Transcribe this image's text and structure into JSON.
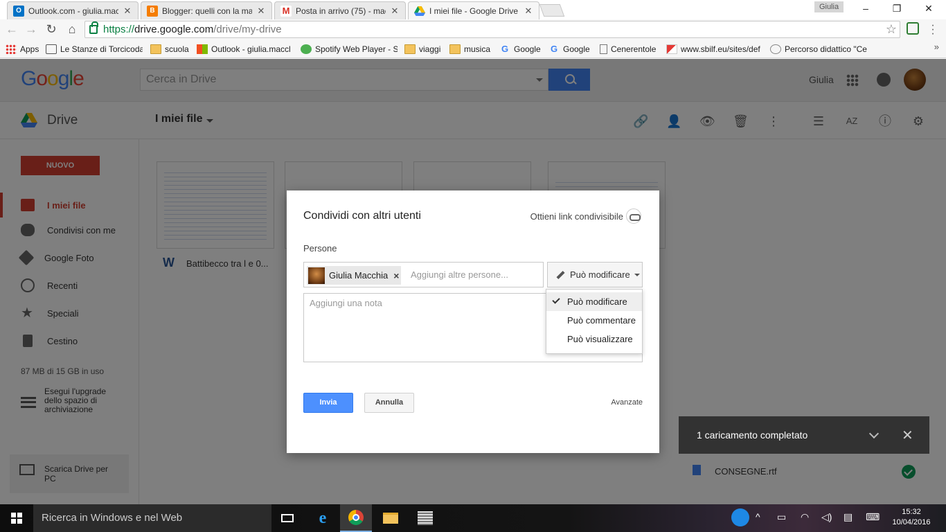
{
  "browser": {
    "tabs": [
      {
        "title": "Outlook.com - giulia.macc",
        "favicon": "outlook-icon",
        "color": "#0072c6"
      },
      {
        "title": "Blogger: quelli con la mac",
        "favicon": "blogger-icon",
        "color": "#f57d00"
      },
      {
        "title": "Posta in arrivo (75) - macc",
        "favicon": "gmail-icon",
        "color": "#d93025"
      },
      {
        "title": "I miei file - Google Drive",
        "favicon": "drive-icon",
        "color": "#fbbc05",
        "active": true
      }
    ],
    "profile_name": "Giulia",
    "window_controls": {
      "minimize": "–",
      "restore": "❐",
      "close": "✕"
    },
    "url": {
      "scheme": "https://",
      "host": "drive.google.com",
      "path": "/drive/my-drive"
    },
    "bookmarks": [
      {
        "label": "Apps",
        "icon": "apps-grid-icon"
      },
      {
        "label": "Le Stanze di Torcicoda",
        "icon": "bookmark-icon"
      },
      {
        "label": "scuola",
        "icon": "folder-icon"
      },
      {
        "label": "Outlook - giulia.maccl",
        "icon": "microsoft-icon"
      },
      {
        "label": "Spotify Web Player - S",
        "icon": "spotify-icon"
      },
      {
        "label": "viaggi",
        "icon": "folder-icon"
      },
      {
        "label": "musica",
        "icon": "folder-icon"
      },
      {
        "label": "Google",
        "icon": "google-icon"
      },
      {
        "label": "Google",
        "icon": "google-icon"
      },
      {
        "label": "Cenerentole",
        "icon": "page-icon"
      },
      {
        "label": "www.sbilf.eu/sites/def",
        "icon": "page-icon"
      },
      {
        "label": "Percorso didattico \"Ce",
        "icon": "seal-icon"
      }
    ],
    "bookmarks_more": "»"
  },
  "drive": {
    "logo_letters": [
      "G",
      "o",
      "o",
      "g",
      "l",
      "e"
    ],
    "search_placeholder": "Cerca in Drive",
    "user_name": "Giulia",
    "app_name": "Drive",
    "location": "I miei file",
    "toolbar_icons": [
      "link-icon",
      "add-person-icon",
      "preview-eye-icon",
      "trash-icon",
      "more-vert-icon",
      "list-view-icon",
      "sort-az-icon",
      "info-icon",
      "settings-gear-icon"
    ],
    "toolbar_glyphs": [
      "🔗",
      "👤",
      "👁",
      "🗑",
      "⋮",
      "☰",
      "AZ",
      "ⓘ",
      "⚙"
    ],
    "new_button": "NUOVO",
    "nav": [
      {
        "label": "I miei file",
        "active": true
      },
      {
        "label": "Condivisi con me"
      },
      {
        "label": "Google Foto"
      },
      {
        "label": "Recenti"
      },
      {
        "label": "Speciali"
      },
      {
        "label": "Cestino"
      }
    ],
    "storage": "87 MB di 15 GB in uso",
    "upgrade": "Esegui l'upgrade dello spazio di archiviazione",
    "download": "Scarica Drive per PC",
    "file_name": "Battibecco tra l e 0...",
    "file_type_glyph": "W"
  },
  "share_dialog": {
    "title": "Condividi con altri utenti",
    "get_link": "Ottieni link condivisibile",
    "people_label": "Persone",
    "chip_name": "Giulia Macchia",
    "chip_remove": "×",
    "people_placeholder": "Aggiungi altre persone...",
    "permission": "Può modificare",
    "note_placeholder": "Aggiungi una nota",
    "permission_options": [
      "Può modificare",
      "Può commentare",
      "Può visualizzare"
    ],
    "send": "Invia",
    "cancel": "Annulla",
    "advanced": "Avanzate"
  },
  "upload_toast": {
    "title": "1 caricamento completato",
    "close": "✕",
    "file": "CONSEGNE.rtf"
  },
  "taskbar": {
    "search_text": "Ricerca in Windows e nel Web",
    "time": "15:32",
    "date": "10/04/2016"
  }
}
